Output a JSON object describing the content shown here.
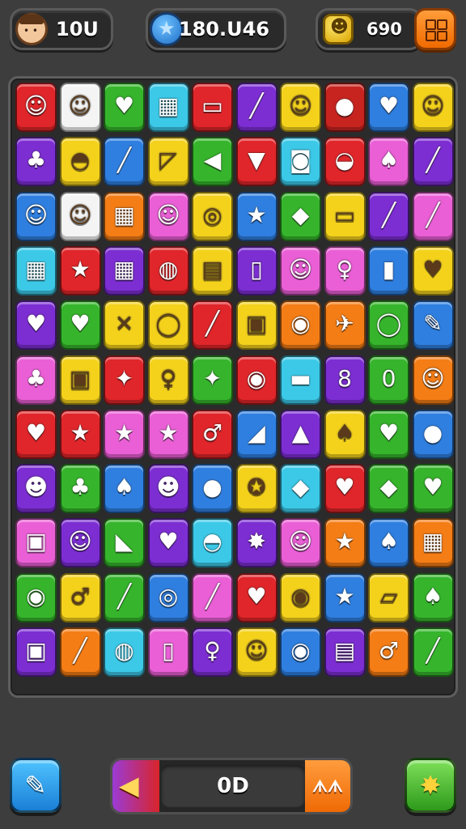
{
  "hud": {
    "lives": "10U",
    "score": "180.U46",
    "coins": "690",
    "lives_icon": "player-face-icon",
    "score_icon": "blue-star-badge-icon",
    "coins_icon": "gold-coin-icon",
    "menu_icon": "grid-menu-icon"
  },
  "bottom": {
    "counter": "0D",
    "right_label": "ᗑᗑ",
    "left_button_icon": "pencil-icon",
    "right_button_icon": "burst-star-icon",
    "left_tip_icon": "cone-icon"
  },
  "colors": {
    "red": "#e0262a",
    "white": "#f4f4f4",
    "green": "#36b52c",
    "cyan": "#3cc9e8",
    "blue": "#2f7fe0",
    "purple": "#7c2ed3",
    "yellow": "#f4d21c",
    "orange": "#f47d16",
    "pink": "#ea5fd6",
    "darkred": "#c72420",
    "lime": "#7bd62c"
  },
  "grid": {
    "rows": 11,
    "cols": 10,
    "tiles": [
      [
        {
          "c": "red",
          "s": "☺",
          "i": "face"
        },
        {
          "c": "white",
          "s": "☺",
          "i": "face"
        },
        {
          "c": "green",
          "s": "♥",
          "i": "heart"
        },
        {
          "c": "cyan",
          "s": "▦",
          "i": "shop"
        },
        {
          "c": "red",
          "s": "▭",
          "i": "cake"
        },
        {
          "c": "purple",
          "s": "╱",
          "i": "pencil"
        },
        {
          "c": "yellow",
          "s": "☺",
          "i": "face"
        },
        {
          "c": "darkred",
          "s": "●",
          "i": "button"
        },
        {
          "c": "blue",
          "s": "♥",
          "i": "heart"
        },
        {
          "c": "yellow",
          "s": "☺",
          "i": "face"
        }
      ],
      [
        {
          "c": "purple",
          "s": "♣",
          "i": "icecream"
        },
        {
          "c": "yellow",
          "s": "◓",
          "i": "macaron"
        },
        {
          "c": "blue",
          "s": "╱",
          "i": "lollipop"
        },
        {
          "c": "yellow",
          "s": "◸",
          "i": "cheese"
        },
        {
          "c": "green",
          "s": "◀",
          "i": "arrow"
        },
        {
          "c": "red",
          "s": "▼",
          "i": "cone"
        },
        {
          "c": "cyan",
          "s": "◙",
          "i": "box"
        },
        {
          "c": "red",
          "s": "◒",
          "i": "burger"
        },
        {
          "c": "pink",
          "s": "♠",
          "i": "icecream"
        },
        {
          "c": "purple",
          "s": "╱",
          "i": "lollipop"
        }
      ],
      [
        {
          "c": "blue",
          "s": "☺",
          "i": "face"
        },
        {
          "c": "white",
          "s": "☺",
          "i": "face"
        },
        {
          "c": "orange",
          "s": "▦",
          "i": "building"
        },
        {
          "c": "pink",
          "s": "☺",
          "i": "face"
        },
        {
          "c": "yellow",
          "s": "◎",
          "i": "ring"
        },
        {
          "c": "blue",
          "s": "★",
          "i": "star"
        },
        {
          "c": "green",
          "s": "◆",
          "i": "candy"
        },
        {
          "c": "yellow",
          "s": "▭",
          "i": "cake"
        },
        {
          "c": "purple",
          "s": "╱",
          "i": "pepper"
        },
        {
          "c": "pink",
          "s": "╱",
          "i": "cone"
        }
      ],
      [
        {
          "c": "cyan",
          "s": "▦",
          "i": "shop"
        },
        {
          "c": "red",
          "s": "★",
          "i": "star"
        },
        {
          "c": "purple",
          "s": "▦",
          "i": "store"
        },
        {
          "c": "red",
          "s": "◍",
          "i": "shell"
        },
        {
          "c": "yellow",
          "s": "▤",
          "i": "cake"
        },
        {
          "c": "purple",
          "s": "▯",
          "i": "tube"
        },
        {
          "c": "pink",
          "s": "☺",
          "i": "face"
        },
        {
          "c": "pink",
          "s": "♀",
          "i": "mirror"
        },
        {
          "c": "blue",
          "s": "▮",
          "i": "book"
        },
        {
          "c": "yellow",
          "s": "♥",
          "i": "heart"
        }
      ],
      [
        {
          "c": "purple",
          "s": "♥",
          "i": "heart"
        },
        {
          "c": "green",
          "s": "♥",
          "i": "heart"
        },
        {
          "c": "yellow",
          "s": "✕",
          "i": "cross"
        },
        {
          "c": "yellow",
          "s": "◯",
          "i": "ring"
        },
        {
          "c": "red",
          "s": "╱",
          "i": "pen"
        },
        {
          "c": "yellow",
          "s": "▣",
          "i": "frame"
        },
        {
          "c": "orange",
          "s": "◉",
          "i": "swirl"
        },
        {
          "c": "orange",
          "s": "✈",
          "i": "plane"
        },
        {
          "c": "green",
          "s": "◯",
          "i": "ring"
        },
        {
          "c": "blue",
          "s": "✎",
          "i": "pencil"
        }
      ],
      [
        {
          "c": "pink",
          "s": "♣",
          "i": "chicken"
        },
        {
          "c": "yellow",
          "s": "▣",
          "i": "robot"
        },
        {
          "c": "red",
          "s": "✦",
          "i": "splat"
        },
        {
          "c": "yellow",
          "s": "♀",
          "i": "mirror"
        },
        {
          "c": "green",
          "s": "✦",
          "i": "sparkle"
        },
        {
          "c": "red",
          "s": "◉",
          "i": "swirl"
        },
        {
          "c": "cyan",
          "s": "▬",
          "i": "bar"
        },
        {
          "c": "purple",
          "s": "8",
          "i": "eight"
        },
        {
          "c": "green",
          "s": "0",
          "i": "zero"
        },
        {
          "c": "orange",
          "s": "☺",
          "i": "face"
        }
      ],
      [
        {
          "c": "red",
          "s": "♥",
          "i": "heart"
        },
        {
          "c": "red",
          "s": "★",
          "i": "star"
        },
        {
          "c": "pink",
          "s": "★",
          "i": "star"
        },
        {
          "c": "pink",
          "s": "★",
          "i": "star"
        },
        {
          "c": "red",
          "s": "♂",
          "i": "magnifier"
        },
        {
          "c": "blue",
          "s": "◢",
          "i": "flag"
        },
        {
          "c": "purple",
          "s": "▲",
          "i": "hat"
        },
        {
          "c": "yellow",
          "s": "♠",
          "i": "leaf"
        },
        {
          "c": "green",
          "s": "♥",
          "i": "heart"
        },
        {
          "c": "blue",
          "s": "●",
          "i": "ball"
        }
      ],
      [
        {
          "c": "purple",
          "s": "☻",
          "i": "drop-face"
        },
        {
          "c": "green",
          "s": "♣",
          "i": "fruit"
        },
        {
          "c": "blue",
          "s": "♠",
          "i": "leaf"
        },
        {
          "c": "purple",
          "s": "☻",
          "i": "bag"
        },
        {
          "c": "blue",
          "s": "●",
          "i": "ball"
        },
        {
          "c": "yellow",
          "s": "✪",
          "i": "badge"
        },
        {
          "c": "cyan",
          "s": "◆",
          "i": "candy"
        },
        {
          "c": "red",
          "s": "♥",
          "i": "heart"
        },
        {
          "c": "green",
          "s": "◆",
          "i": "candy"
        },
        {
          "c": "green",
          "s": "♥",
          "i": "heart"
        }
      ],
      [
        {
          "c": "pink",
          "s": "▣",
          "i": "jar"
        },
        {
          "c": "purple",
          "s": "☺",
          "i": "face"
        },
        {
          "c": "green",
          "s": "◣",
          "i": "slice"
        },
        {
          "c": "purple",
          "s": "♥",
          "i": "bag"
        },
        {
          "c": "cyan",
          "s": "◓",
          "i": "burger"
        },
        {
          "c": "purple",
          "s": "✸",
          "i": "burst"
        },
        {
          "c": "pink",
          "s": "☺",
          "i": "face"
        },
        {
          "c": "orange",
          "s": "★",
          "i": "star"
        },
        {
          "c": "blue",
          "s": "♠",
          "i": "flower"
        },
        {
          "c": "orange",
          "s": "▦",
          "i": "store"
        }
      ],
      [
        {
          "c": "green",
          "s": "◉",
          "i": "ring"
        },
        {
          "c": "yellow",
          "s": "♂",
          "i": "pacifier"
        },
        {
          "c": "green",
          "s": "╱",
          "i": "bottle"
        },
        {
          "c": "blue",
          "s": "◎",
          "i": "ring"
        },
        {
          "c": "pink",
          "s": "╱",
          "i": "pencil"
        },
        {
          "c": "red",
          "s": "♥",
          "i": "heart"
        },
        {
          "c": "yellow",
          "s": "◉",
          "i": "swirl"
        },
        {
          "c": "blue",
          "s": "★",
          "i": "star"
        },
        {
          "c": "yellow",
          "s": "▱",
          "i": "cup"
        },
        {
          "c": "green",
          "s": "♠",
          "i": "leaf"
        }
      ],
      [
        {
          "c": "purple",
          "s": "▣",
          "i": "robot"
        },
        {
          "c": "orange",
          "s": "╱",
          "i": "tooth"
        },
        {
          "c": "cyan",
          "s": "◍",
          "i": "drum"
        },
        {
          "c": "pink",
          "s": "▯",
          "i": "bottle"
        },
        {
          "c": "purple",
          "s": "♀",
          "i": "mirror"
        },
        {
          "c": "yellow",
          "s": "☺",
          "i": "face"
        },
        {
          "c": "blue",
          "s": "◉",
          "i": "ring"
        },
        {
          "c": "purple",
          "s": "▤",
          "i": "phone"
        },
        {
          "c": "orange",
          "s": "♂",
          "i": "lollipop"
        },
        {
          "c": "green",
          "s": "╱",
          "i": "hook"
        }
      ]
    ]
  }
}
